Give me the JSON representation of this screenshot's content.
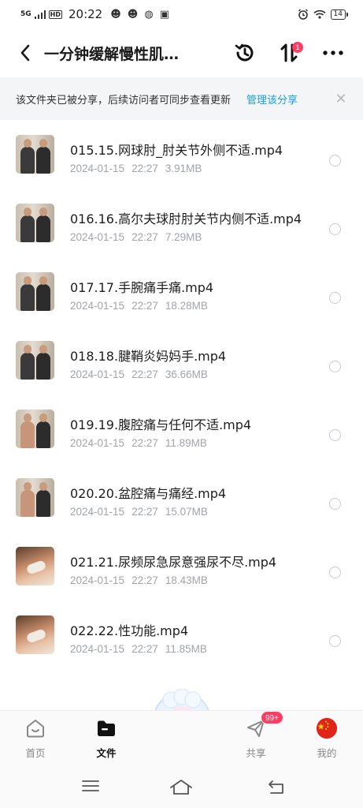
{
  "status_bar": {
    "signal": "5G",
    "hd": "HD",
    "time": "20:22",
    "battery": "14"
  },
  "header": {
    "title": "一分钟缓解慢性肌…",
    "sort_badge": "1"
  },
  "share_banner": {
    "text": "该文件夹已被分享，后续访问者可同步查看更新",
    "link": "管理该分享",
    "close": "✕"
  },
  "files": [
    {
      "name": "015.15.网球肘_肘关节外侧不适.mp4",
      "date": "2024-01-15",
      "time": "22:27",
      "size": "3.91MB",
      "thumb": "duo"
    },
    {
      "name": "016.16.高尔夫球肘肘关节内侧不适.mp4",
      "date": "2024-01-15",
      "time": "22:27",
      "size": "7.29MB",
      "thumb": "duo"
    },
    {
      "name": "017.17.手腕痛手痛.mp4",
      "date": "2024-01-15",
      "time": "22:27",
      "size": "18.28MB",
      "thumb": "duo"
    },
    {
      "name": "018.18.腱鞘炎妈妈手.mp4",
      "date": "2024-01-15",
      "time": "22:27",
      "size": "36.66MB",
      "thumb": "duo"
    },
    {
      "name": "019.19.腹腔痛与任何不适.mp4",
      "date": "2024-01-15",
      "time": "22:27",
      "size": "11.89MB",
      "thumb": "duo-light"
    },
    {
      "name": "020.20.盆腔痛与痛经.mp4",
      "date": "2024-01-15",
      "time": "22:27",
      "size": "15.07MB",
      "thumb": "duo-light"
    },
    {
      "name": "021.21.尿频尿急尿意强尿不尽.mp4",
      "date": "2024-01-15",
      "time": "22:27",
      "size": "18.43MB",
      "thumb": "closeup"
    },
    {
      "name": "022.22.性功能.mp4",
      "date": "2024-01-15",
      "time": "22:27",
      "size": "11.85MB",
      "thumb": "closeup"
    }
  ],
  "bottom_nav": {
    "home": "首页",
    "files": "文件",
    "share": "共享",
    "share_badge": "99+",
    "me": "我的"
  },
  "colors": {
    "accent": "#1a9fe8",
    "badge": "#ff3c64"
  }
}
